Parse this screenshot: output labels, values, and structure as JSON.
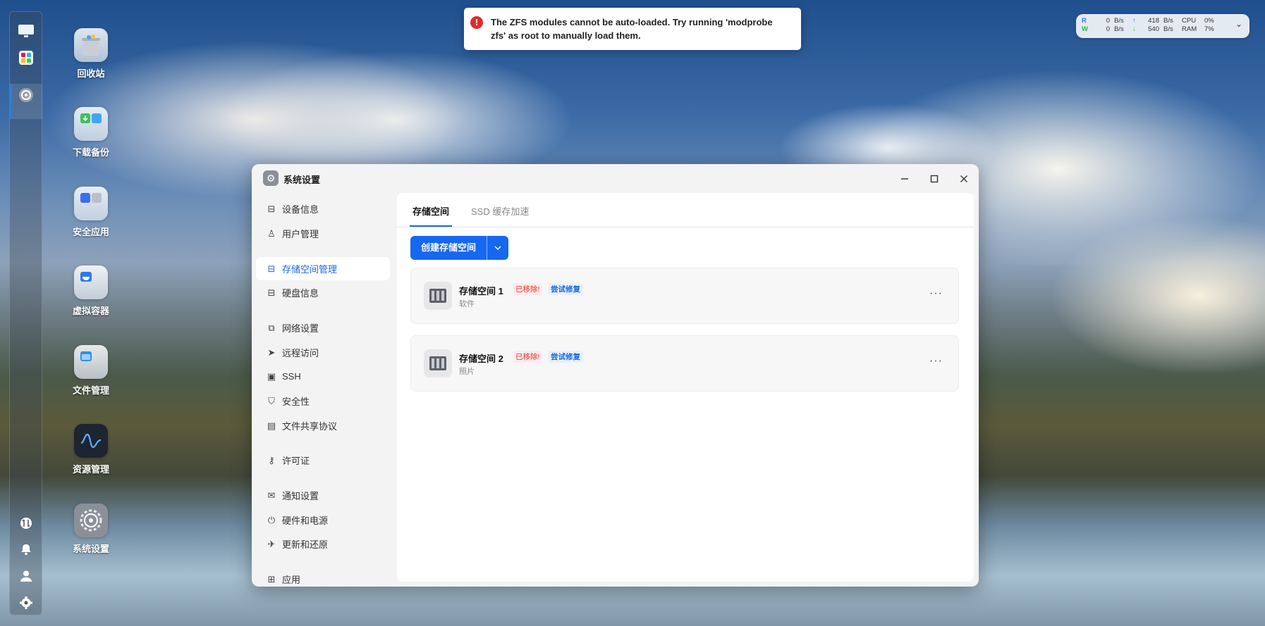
{
  "notification": {
    "text": "The ZFS modules cannot be auto-loaded. Try running 'modprobe zfs' as root to manually load them."
  },
  "stats": {
    "read_label": "R",
    "read_value": "0",
    "read_unit": "B/s",
    "write_label": "W",
    "write_value": "0",
    "write_unit": "B/s",
    "up_value": "418",
    "up_unit": "B/s",
    "down_value": "540",
    "down_unit": "B/s",
    "cpu_label": "CPU",
    "cpu_value": "0%",
    "ram_label": "RAM",
    "ram_value": "7%"
  },
  "desktop_icons": [
    {
      "label": "回收站"
    },
    {
      "label": "下载备份"
    },
    {
      "label": "安全应用"
    },
    {
      "label": "虚拟容器"
    },
    {
      "label": "文件管理"
    },
    {
      "label": "资源管理"
    },
    {
      "label": "系统设置"
    }
  ],
  "window": {
    "title": "系统设置",
    "sidebar": [
      {
        "label": "设备信息",
        "icon": "drive-icon"
      },
      {
        "label": "用户管理",
        "icon": "user-gear-icon"
      },
      {
        "label": "存储空间管理",
        "icon": "storage-icon",
        "active": true
      },
      {
        "label": "硬盘信息",
        "icon": "drive-icon"
      },
      {
        "label": "网络设置",
        "icon": "network-icon"
      },
      {
        "label": "远程访问",
        "icon": "send-icon"
      },
      {
        "label": "SSH",
        "icon": "terminal-icon"
      },
      {
        "label": "安全性",
        "icon": "shield-icon"
      },
      {
        "label": "文件共享协议",
        "icon": "document-icon"
      },
      {
        "label": "许可证",
        "icon": "key-icon"
      },
      {
        "label": "通知设置",
        "icon": "mail-icon"
      },
      {
        "label": "硬件和电源",
        "icon": "power-icon"
      },
      {
        "label": "更新和还原",
        "icon": "rocket-icon"
      },
      {
        "label": "应用",
        "icon": "apps-icon"
      }
    ],
    "tabs": [
      {
        "label": "存储空间",
        "active": true
      },
      {
        "label": "SSD 缓存加速"
      }
    ],
    "create_button": "创建存储空间",
    "storage_spaces": [
      {
        "name": "存储空间 1",
        "status": "已移除!",
        "action": "尝试修复",
        "sub": "软件"
      },
      {
        "name": "存储空间 2",
        "status": "已移除!",
        "action": "尝试修复",
        "sub": "照片"
      }
    ]
  },
  "colors": {
    "accent": "#1668f0",
    "error": "#e03030"
  }
}
